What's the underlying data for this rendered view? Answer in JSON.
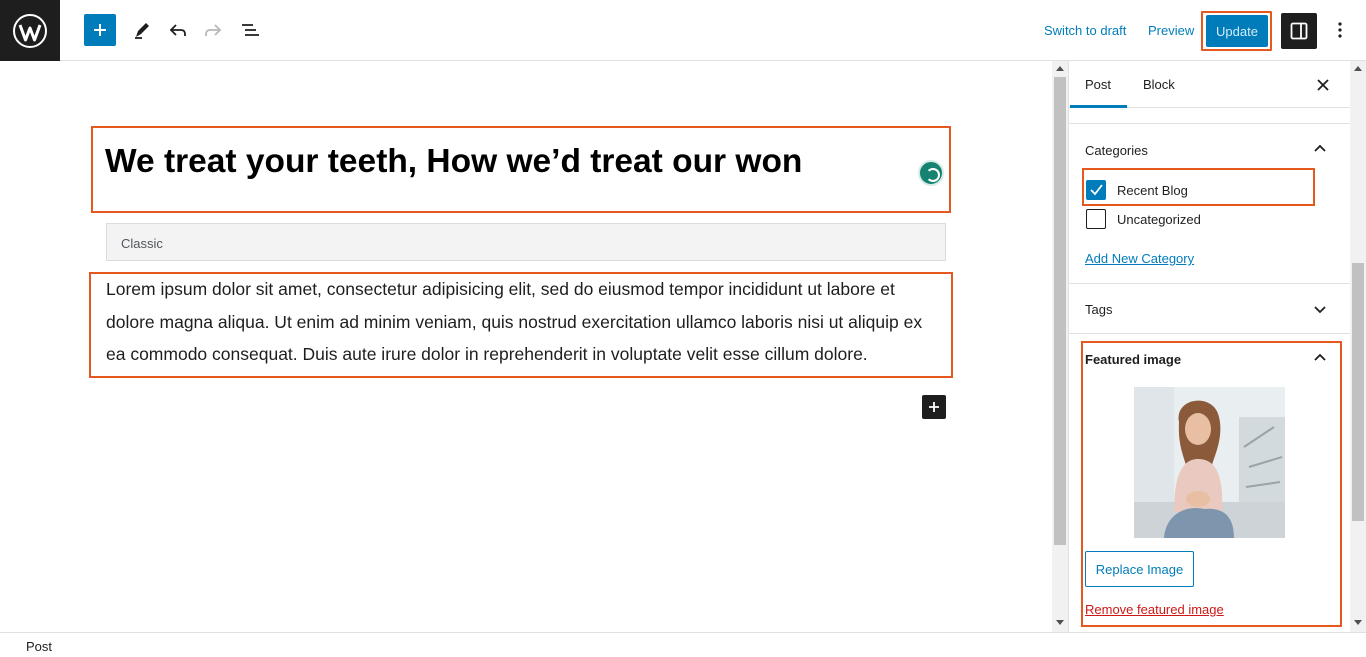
{
  "toolbar": {
    "logo_icon": "wordpress-logo-icon",
    "add_block_icon": "plus-icon",
    "tools_icon": "pencil-icon",
    "undo_icon": "undo-icon",
    "redo_icon": "redo-icon",
    "list_view_icon": "list-view-icon",
    "switch_to_draft": "Switch to draft",
    "preview": "Preview",
    "update": "Update",
    "settings_icon": "sidebar-toggle-icon",
    "options_icon": "kebab-menu-icon"
  },
  "editor": {
    "post_title": "We treat your teeth, How we’d treat our won",
    "classic_label": "Classic",
    "paragraph": "Lorem ipsum dolor sit amet, consectetur adipisicing elit, sed do eiusmod tempor incididunt ut labore et dolore magna aliqua. Ut enim ad minim veniam, quis nostrud exercitation ullamco laboris nisi ut aliquip ex ea commodo consequat. Duis aute irure dolor in reprehenderit in voluptate velit esse cillum dolore.",
    "inserter_icon": "plus-icon"
  },
  "sidebar": {
    "tabs": [
      {
        "label": "Post",
        "active": true
      },
      {
        "label": "Block",
        "active": false
      }
    ],
    "close_icon": "close-icon",
    "categories": {
      "title": "Categories",
      "items": [
        {
          "label": "Recent Blog",
          "checked": true
        },
        {
          "label": "Uncategorized",
          "checked": false
        }
      ],
      "add_new": "Add New Category"
    },
    "tags": {
      "title": "Tags"
    },
    "featured_image": {
      "title": "Featured image",
      "replace": "Replace Image",
      "remove": "Remove featured image"
    }
  },
  "footer": {
    "breadcrumb": "Post"
  },
  "colors": {
    "accent": "#007cba",
    "highlight": "#e5581f",
    "danger": "#cc1818",
    "dark": "#1e1e1e"
  }
}
